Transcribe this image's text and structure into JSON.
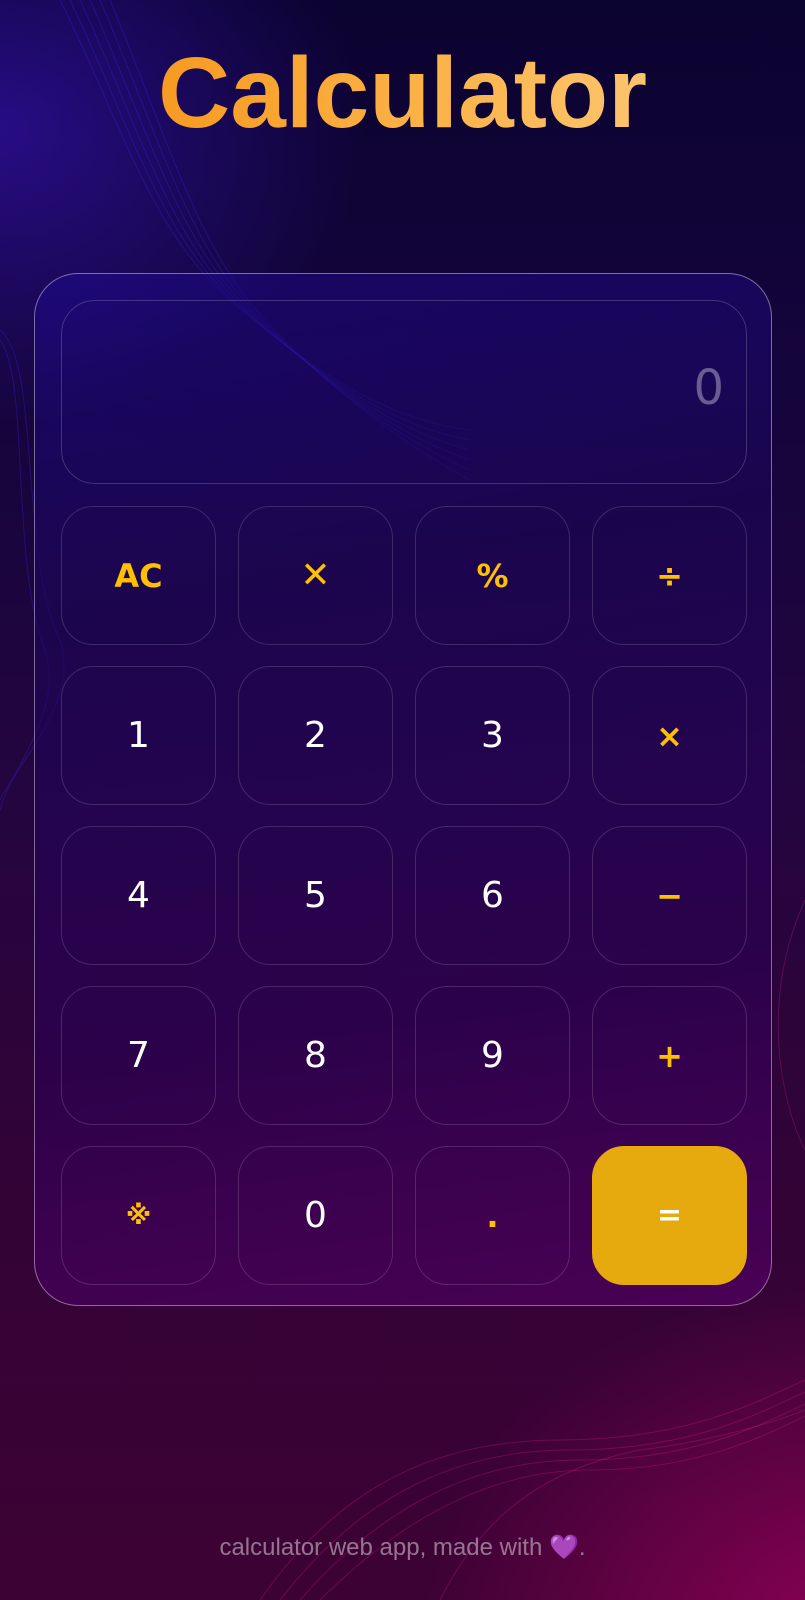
{
  "header": {
    "title": "Calculator"
  },
  "display": {
    "value": "0"
  },
  "keys": {
    "clear": "AC",
    "backspace": "✕",
    "percent": "%",
    "divide": "÷",
    "one": "1",
    "two": "2",
    "three": "3",
    "multiply": "×",
    "four": "4",
    "five": "5",
    "six": "6",
    "subtract": "−",
    "seven": "7",
    "eight": "8",
    "nine": "9",
    "add": "+",
    "special": "※",
    "zero": "0",
    "decimal": ".",
    "equals": "="
  },
  "footer": {
    "text": "calculator web app, made with",
    "heart": "💜",
    "end": "."
  },
  "colors": {
    "accent": "#ffc000",
    "equals_bg": "#e6a90e",
    "title_from": "#f48c0a",
    "title_to": "#fdd08a"
  }
}
